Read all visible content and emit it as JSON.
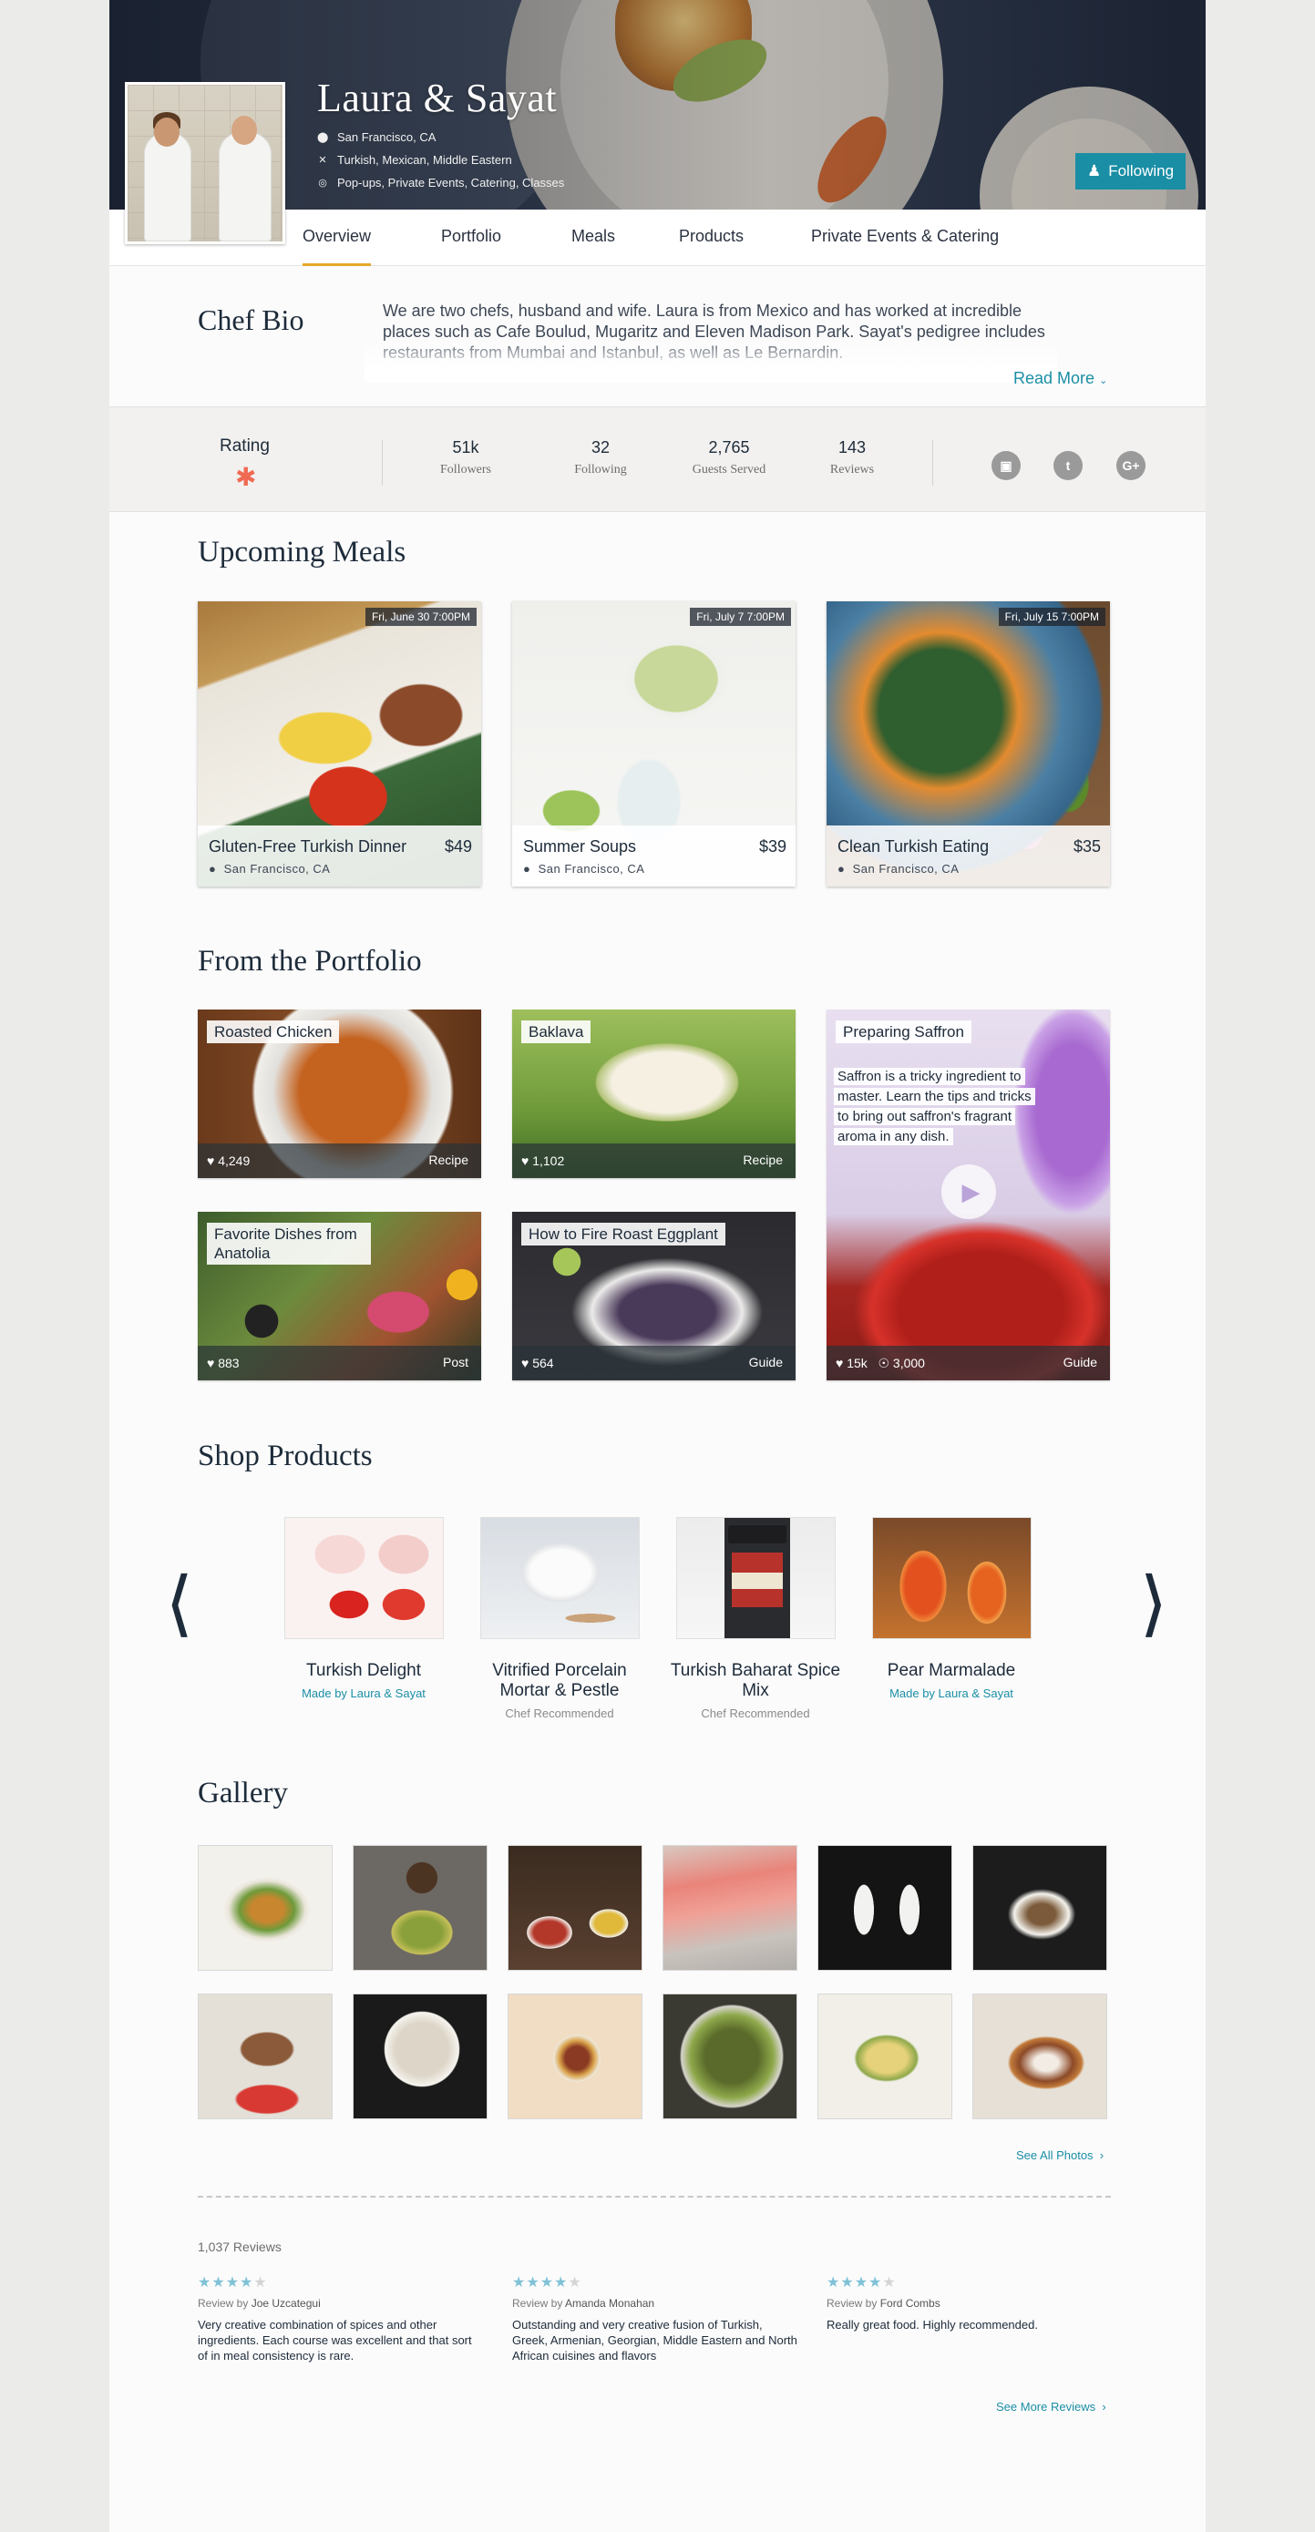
{
  "header": {
    "name": "Laura & Sayat",
    "location": "San Francisco, CA",
    "cuisines": "Turkish, Mexican, Middle Eastern",
    "services": "Pop-ups, Private Events, Catering, Classes",
    "follow_label": "Following"
  },
  "tabs": [
    "Overview",
    "Portfolio",
    "Meals",
    "Products",
    "Private Events & Catering"
  ],
  "bio": {
    "title": "Chef Bio",
    "text": "We are two chefs, husband and wife. Laura is from Mexico and has worked at incredible places such as Cafe Boulud, Mugaritz and Eleven Madison Park. Sayat's pedigree includes restaurants from Mumbai and Istanbul, as well as Le Bernardin.",
    "read_more": "Read More"
  },
  "stats": {
    "rating_label": "Rating",
    "items": [
      {
        "value": "51k",
        "label": "Followers"
      },
      {
        "value": "32",
        "label": "Following"
      },
      {
        "value": "2,765",
        "label": "Guests Served"
      },
      {
        "value": "143",
        "label": "Reviews"
      }
    ],
    "social": [
      "instagram-icon",
      "twitter-icon",
      "google-plus-icon"
    ]
  },
  "upcoming": {
    "title": "Upcoming Meals",
    "meals": [
      {
        "date": "Fri, June 30 7:00PM",
        "title": "Gluten-Free Turkish Dinner",
        "price": "$49",
        "location": "San Francisco, CA"
      },
      {
        "date": "Fri, July 7 7:00PM",
        "title": "Summer Soups",
        "price": "$39",
        "location": "San Francisco, CA"
      },
      {
        "date": "Fri, July 15 7:00PM",
        "title": "Clean Turkish Eating",
        "price": "$35",
        "location": "San Francisco, CA"
      }
    ]
  },
  "portfolio": {
    "title": "From the Portfolio",
    "items": [
      {
        "title": "Roasted Chicken",
        "likes": "4,249",
        "kind": "Recipe"
      },
      {
        "title": "Baklava",
        "likes": "1,102",
        "kind": "Recipe"
      },
      {
        "title": "Favorite Dishes from Anatolia",
        "likes": "883",
        "kind": "Post"
      },
      {
        "title": "How to Fire Roast Eggplant",
        "likes": "564",
        "kind": "Guide"
      },
      {
        "title": "Preparing Saffron",
        "desc": "Saffron is a tricky ingredient to master. Learn the tips and tricks to bring out saffron's fragrant aroma in any dish.",
        "likes": "15k",
        "views": "3,000",
        "kind": "Guide"
      }
    ]
  },
  "products": {
    "title": "Shop Products",
    "items": [
      {
        "name": "Turkish Delight",
        "sub": "Made by Laura & Sayat"
      },
      {
        "name": "Vitrified Porcelain Mortar & Pestle",
        "sub": "Chef Recommended"
      },
      {
        "name": "Turkish Baharat Spice Mix",
        "sub": "Chef Recommended"
      },
      {
        "name": "Pear Marmalade",
        "sub": "Made by Laura & Sayat"
      }
    ]
  },
  "gallery": {
    "title": "Gallery",
    "see_all": "See All Photos"
  },
  "reviews": {
    "count": "1,037 Reviews",
    "items": [
      {
        "stars": 4,
        "by_prefix": "Review by",
        "author": "Joe Uzcategui",
        "text": "Very creative combination of spices and other ingredients. Each course was excellent and that sort of in meal consistency is rare."
      },
      {
        "stars": 4,
        "by_prefix": "Review by",
        "author": "Amanda Monahan",
        "text": "Outstanding and very creative fusion of Turkish, Greek, Armenian, Georgian, Middle Eastern and North African cuisines and flavors"
      },
      {
        "stars": 4,
        "by_prefix": "Review by",
        "author": "Ford Combs",
        "text": "Really great food. Highly recommended."
      }
    ],
    "see_more": "See More Reviews"
  },
  "colors": {
    "accent": "#1a8ea5",
    "tab_underline": "#e4a82a",
    "rating_star": "#f06a53"
  }
}
